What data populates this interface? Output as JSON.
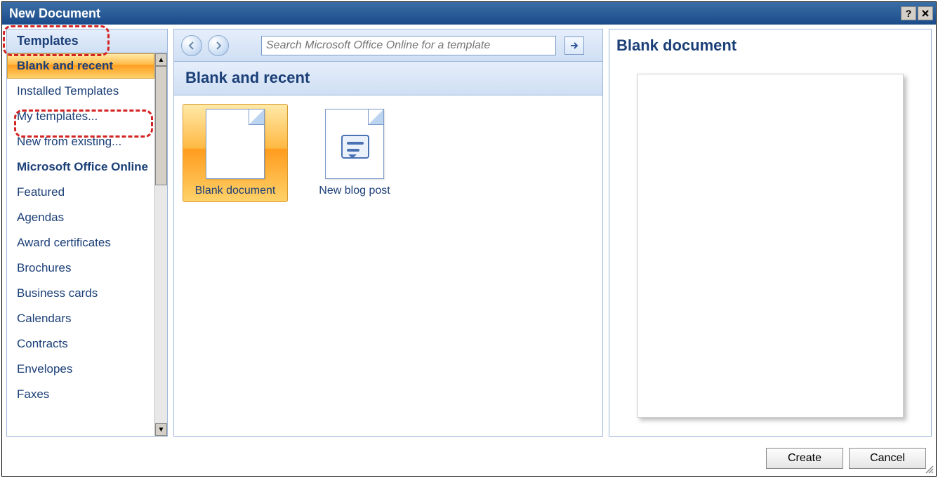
{
  "window": {
    "title": "New Document"
  },
  "sidebar": {
    "header": "Templates",
    "items": [
      {
        "label": "Blank and recent",
        "active": true
      },
      {
        "label": "Installed Templates"
      },
      {
        "label": "My templates..."
      },
      {
        "label": "New from existing..."
      },
      {
        "label": "Microsoft Office Online",
        "section": true
      },
      {
        "label": "Featured"
      },
      {
        "label": "Agendas"
      },
      {
        "label": "Award certificates"
      },
      {
        "label": "Brochures"
      },
      {
        "label": "Business cards"
      },
      {
        "label": "Calendars"
      },
      {
        "label": "Contracts"
      },
      {
        "label": "Envelopes"
      },
      {
        "label": "Faxes"
      }
    ]
  },
  "toolbar": {
    "search_placeholder": "Search Microsoft Office Online for a template"
  },
  "center": {
    "section_title": "Blank and recent",
    "items": [
      {
        "label": "Blank document",
        "selected": true
      },
      {
        "label": "New blog post"
      }
    ]
  },
  "preview": {
    "title": "Blank document"
  },
  "footer": {
    "create": "Create",
    "cancel": "Cancel"
  }
}
